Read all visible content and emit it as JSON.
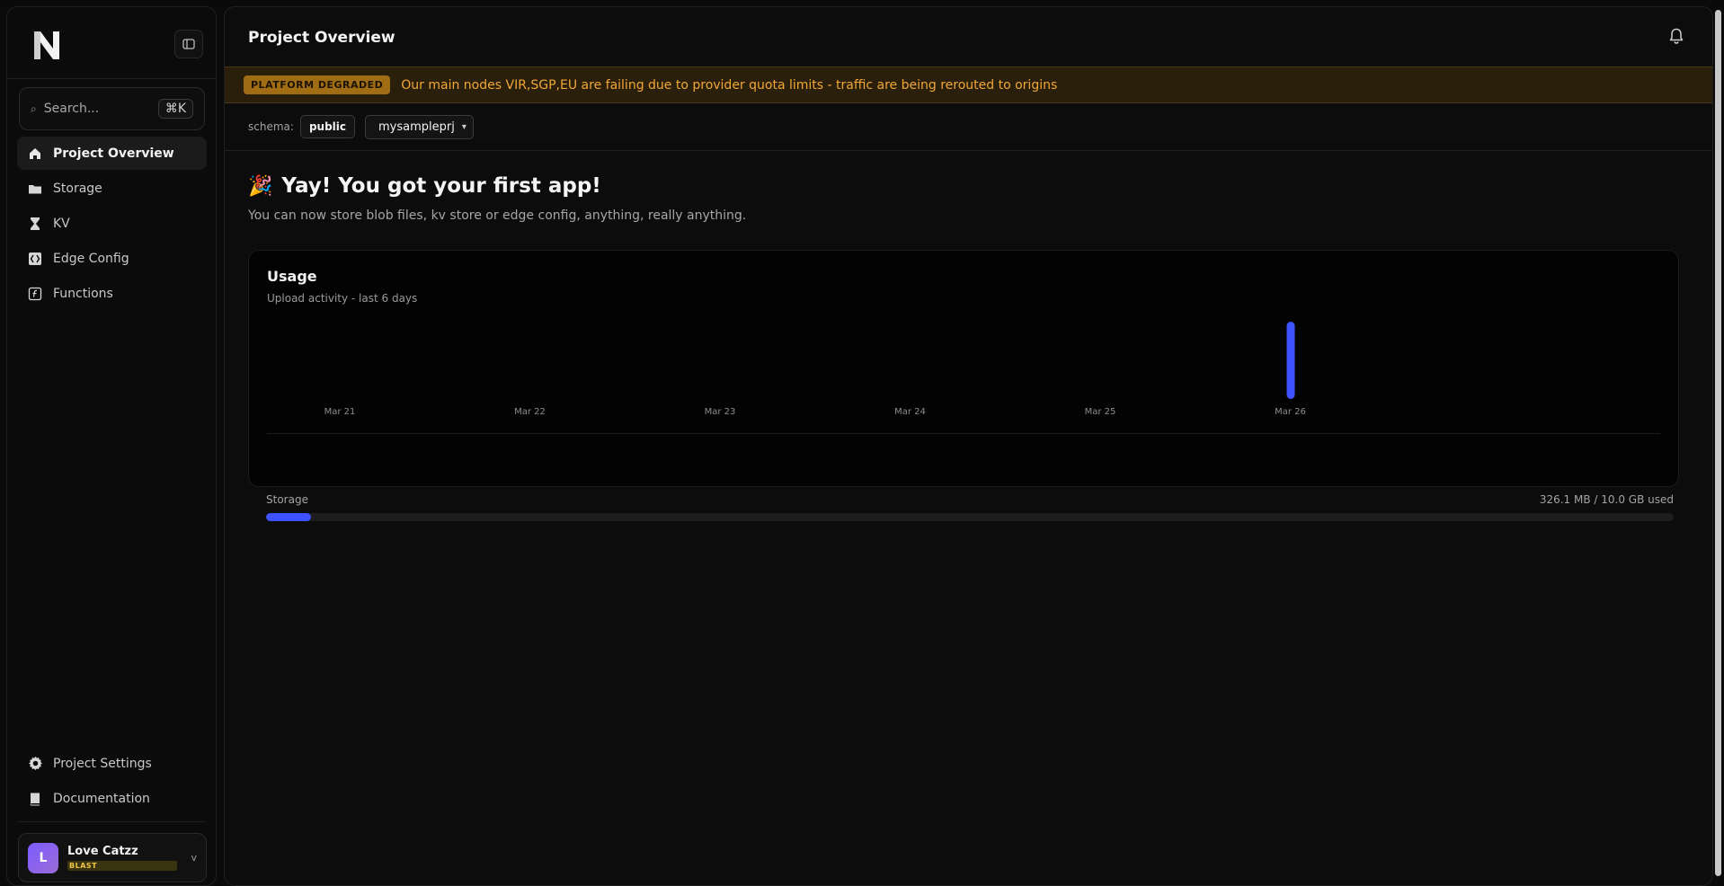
{
  "sidebar": {
    "logo_letter": "N",
    "search": {
      "placeholder": "Search...",
      "shortcut": "⌘K"
    },
    "nav_items": [
      {
        "label": "Project Overview",
        "icon": "home-icon",
        "active": true
      },
      {
        "label": "Storage",
        "icon": "folder-icon"
      },
      {
        "label": "KV",
        "icon": "hourglass-icon"
      },
      {
        "label": "Edge Config",
        "icon": "code-brackets-icon"
      },
      {
        "label": "Functions",
        "icon": "function-icon"
      }
    ],
    "bottom_items": [
      {
        "label": "Project Settings",
        "icon": "gear-icon"
      },
      {
        "label": "Documentation",
        "icon": "book-icon"
      }
    ],
    "user": {
      "initial": "L",
      "name": "Love Catzz",
      "plan": "BLAST"
    }
  },
  "header": {
    "title": "Project Overview"
  },
  "banner": {
    "badge": "PLATFORM DEGRADED",
    "message": "Our main nodes VIR,SGP,EU are failing due to provider quota limits - traffic are being rerouted to origins"
  },
  "schema": {
    "label": "schema:",
    "value": "public",
    "project": "mysampleprj"
  },
  "hero": {
    "emoji": "🎉",
    "title": "Yay! You got your first app!",
    "subtitle": "You can now store blob files, kv store or edge config, anything, really anything."
  },
  "usage": {
    "title": "Usage",
    "subtitle": "Upload activity - last 6 days",
    "storage_label": "Storage",
    "storage_used": "326.1 MB / 10.0 GB used",
    "storage_fraction": 0.032
  },
  "chart_data": {
    "type": "bar",
    "categories": [
      "Mar 21",
      "Mar 22",
      "Mar 23",
      "Mar 24",
      "Mar 25",
      "Mar 26"
    ],
    "values": [
      0,
      0,
      0,
      0,
      0,
      1
    ],
    "ylim": [
      0,
      1
    ]
  },
  "colors": {
    "accent": "#3f52ff",
    "warning": "#f1a736"
  }
}
